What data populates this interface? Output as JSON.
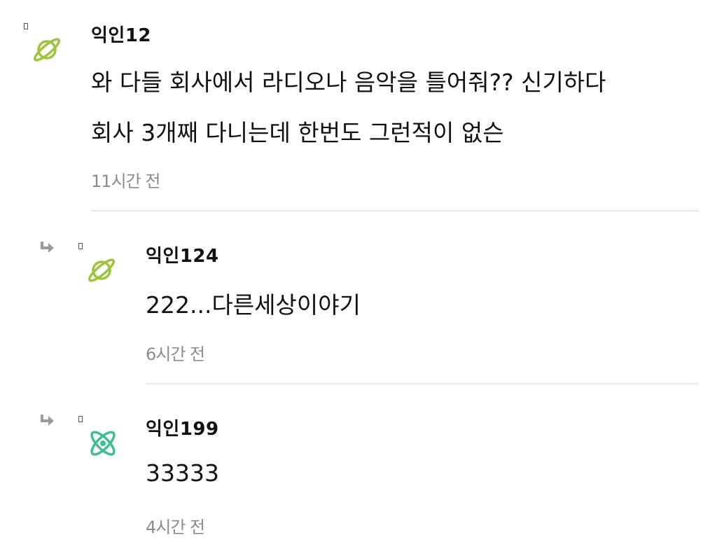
{
  "colors": {
    "planet_green": "#9cc43c",
    "atom_teal": "#3fbf8f",
    "time_gray": "#8c8c8c",
    "divider_gray": "#e9e9e9"
  },
  "comments": [
    {
      "author": "익인12",
      "lines": [
        "와 다들 회사에서 라디오나 음악을 틀어줘?? 신기하다",
        "회사 3개째 다니는데 한번도 그런적이 없슨"
      ],
      "time": "11시간 전",
      "avatar_icon": "planet-icon",
      "is_reply": false
    },
    {
      "author": "익인124",
      "lines": [
        "222...다른세상이야기"
      ],
      "time": "6시간 전",
      "avatar_icon": "planet-icon",
      "is_reply": true
    },
    {
      "author": "익인199",
      "lines": [
        "33333"
      ],
      "time": "4시간 전",
      "avatar_icon": "atom-icon",
      "is_reply": true
    }
  ]
}
